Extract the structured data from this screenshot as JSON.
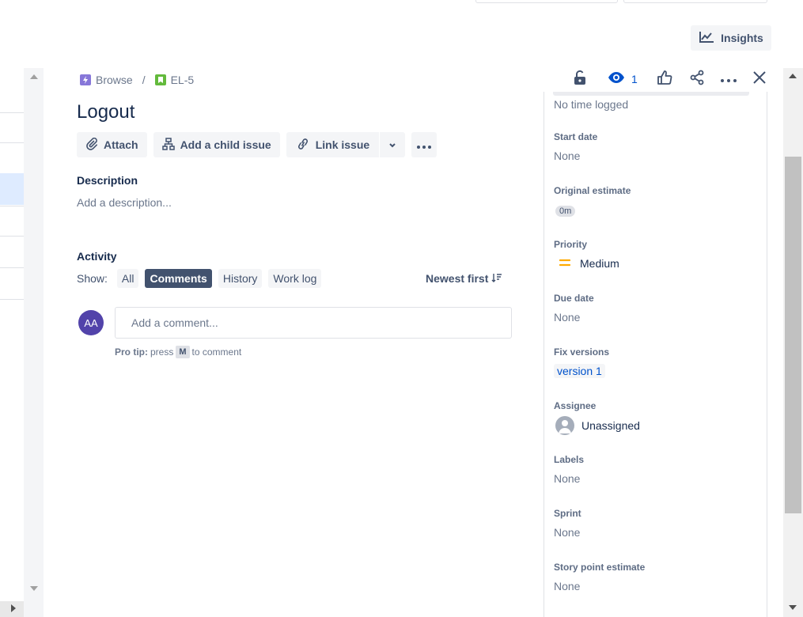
{
  "top_bar": {
    "insights_label": "Insights"
  },
  "breadcrumb": {
    "project_label": "Browse",
    "issue_key": "EL-5"
  },
  "issue": {
    "title": "Logout"
  },
  "toolbar": {
    "attach_label": "Attach",
    "child_issue_label": "Add a child issue",
    "link_issue_label": "Link issue"
  },
  "description": {
    "heading": "Description",
    "placeholder": "Add a description..."
  },
  "activity": {
    "heading": "Activity",
    "show_label": "Show:",
    "filters": [
      {
        "label": "All",
        "active": false
      },
      {
        "label": "Comments",
        "active": true
      },
      {
        "label": "History",
        "active": false
      },
      {
        "label": "Work log",
        "active": false
      }
    ],
    "sort_label": "Newest first"
  },
  "comment": {
    "avatar_initials": "AA",
    "placeholder": "Add a comment...",
    "protip_prefix": "Pro tip:",
    "protip_press": "press",
    "protip_key": "M",
    "protip_suffix": "to comment"
  },
  "header_actions": {
    "watch_count": "1"
  },
  "details": {
    "time_logged": "No time logged",
    "start_date": {
      "label": "Start date",
      "value": "None"
    },
    "original_estimate": {
      "label": "Original estimate",
      "value": "0m"
    },
    "priority": {
      "label": "Priority",
      "value": "Medium"
    },
    "due_date": {
      "label": "Due date",
      "value": "None"
    },
    "fix_versions": {
      "label": "Fix versions",
      "value": "version 1"
    },
    "assignee": {
      "label": "Assignee",
      "value": "Unassigned"
    },
    "labels": {
      "label": "Labels",
      "value": "None"
    },
    "sprint": {
      "label": "Sprint",
      "value": "None"
    },
    "story_points": {
      "label": "Story point estimate",
      "value": "None"
    }
  },
  "colors": {
    "accent": "#0052cc",
    "active_filter": "#42526e",
    "priority_medium": "#ffab00",
    "avatar": "#5243aa"
  }
}
